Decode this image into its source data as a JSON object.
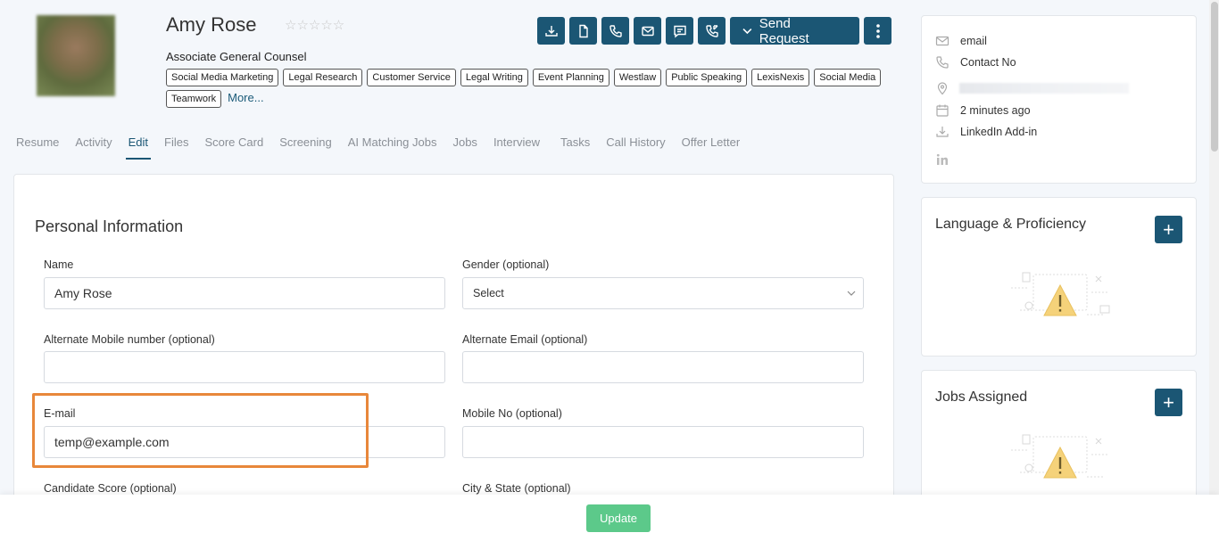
{
  "profile": {
    "name": "Amy Rose",
    "stars": "☆☆☆☆☆",
    "title": "Associate General Counsel",
    "tags": [
      "Social Media Marketing",
      "Legal Research",
      "Customer Service",
      "Legal Writing",
      "Event Planning",
      "Westlaw",
      "Public Speaking",
      "LexisNexis",
      "Social Media",
      "Teamwork"
    ],
    "more_label": "More..."
  },
  "actions": {
    "icons": [
      "download-icon",
      "document-icon",
      "phone-icon",
      "mail-icon",
      "message-icon",
      "call-log-icon"
    ],
    "send_request_label": "Send Request"
  },
  "tabs": [
    "Resume",
    "Activity",
    "Edit",
    "Files",
    "Score Card",
    "Screening",
    "AI Matching Jobs",
    "Jobs",
    "Interview",
    "Tasks",
    "Call History",
    "Offer Letter"
  ],
  "active_tab": "Edit",
  "form": {
    "section_title": "Personal Information",
    "name_label": "Name",
    "name_value": "Amy Rose",
    "gender_label": "Gender (optional)",
    "gender_value": "Select",
    "alt_mobile_label": "Alternate Mobile number (optional)",
    "alt_mobile_value": "",
    "alt_email_label": "Alternate Email (optional)",
    "alt_email_value": "",
    "email_label": "E-mail",
    "email_value": "temp@example.com",
    "mobile_label": "Mobile No (optional)",
    "mobile_value": "",
    "score_label": "Candidate Score (optional)",
    "city_label": "City & State (optional)"
  },
  "contact": {
    "email": "email",
    "phone": "Contact No",
    "updated": "2 minutes ago",
    "linkedin_addin": "LinkedIn Add-in"
  },
  "side": {
    "language_title": "Language & Proficiency",
    "jobs_title": "Jobs Assigned"
  },
  "footer": {
    "update_label": "Update"
  },
  "colors": {
    "primary": "#1b5674",
    "update": "#5cc98a",
    "highlight": "#e8873a"
  }
}
